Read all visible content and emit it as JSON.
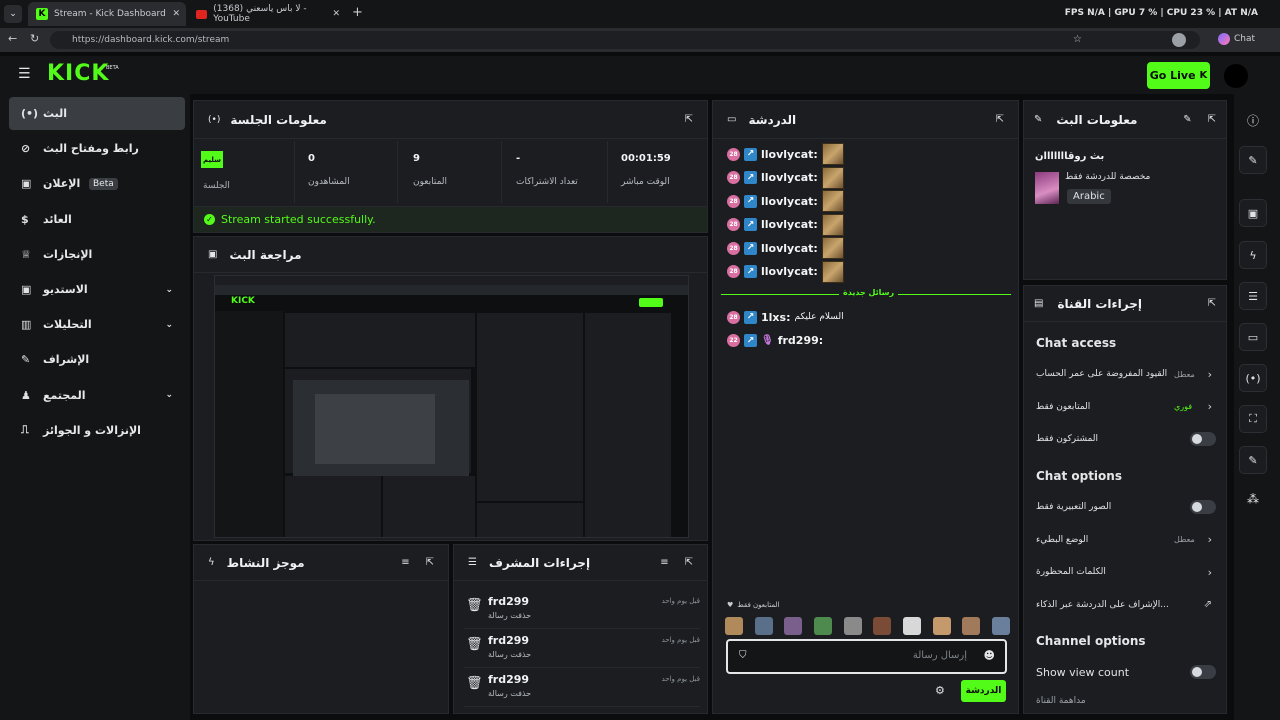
{
  "browser": {
    "tabs": [
      {
        "title": "Stream - Kick Dashboard",
        "active": true
      },
      {
        "title": "(1368) لا باس ياسعني - YouTube",
        "active": false
      }
    ],
    "url": "https://dashboard.kick.com/stream",
    "perf": "FPS N/A | GPU 7 % | CPU 23 % | AT N/A",
    "chat_label": "Chat"
  },
  "app": {
    "logo": "KICK",
    "logo_badge": "BETA",
    "go_live": "Go Live"
  },
  "sidebar": {
    "items": [
      {
        "label": "البث",
        "icon": "(•)",
        "active": true
      },
      {
        "label": "رابط ومفتاح البث",
        "icon": "⊘"
      },
      {
        "label": "الإعلان",
        "icon": "▣",
        "badge": "Beta"
      },
      {
        "label": "العائد",
        "icon": "$"
      },
      {
        "label": "الإنجازات",
        "icon": "♕"
      },
      {
        "label": "الاستديو",
        "icon": "▣",
        "chevron": true
      },
      {
        "label": "التحليلات",
        "icon": "▥",
        "chevron": true
      },
      {
        "label": "الإشراف",
        "icon": "✎"
      },
      {
        "label": "المجتمع",
        "icon": "♟",
        "chevron": true
      },
      {
        "label": "الإنزالات و الجوائز",
        "icon": "⎍"
      }
    ]
  },
  "session": {
    "title": "معلومات الجلسة",
    "stats": [
      {
        "value": "سليم",
        "label": "الجلسة"
      },
      {
        "value": "0",
        "label": "المشاهدون"
      },
      {
        "value": "9",
        "label": "المتابعون"
      },
      {
        "value": "-",
        "label": "تعداد الاشتراكات"
      },
      {
        "value": "00:01:59",
        "label": "الوقت مباشر"
      }
    ],
    "success": "Stream started successfully."
  },
  "preview": {
    "title": "مراجعة البث"
  },
  "activity": {
    "title": "موجز النشاط"
  },
  "modactions": {
    "title": "إجراءات المشرف",
    "rows": [
      {
        "user": "frd299",
        "action": "حذفت رسالة",
        "time": "قبل يوم واحد"
      },
      {
        "user": "frd299",
        "action": "حذفت رسالة",
        "time": "قبل يوم واحد"
      },
      {
        "user": "frd299",
        "action": "حذفت رسالة",
        "time": "قبل يوم واحد"
      }
    ]
  },
  "chat": {
    "title": "الدردشة",
    "messages": [
      {
        "user": "llovlycat:",
        "badge": "28"
      },
      {
        "user": "llovlycat:",
        "badge": "28"
      },
      {
        "user": "llovlycat:",
        "badge": "28"
      },
      {
        "user": "llovlycat:",
        "badge": "28"
      },
      {
        "user": "llovlycat:",
        "badge": "28"
      },
      {
        "user": "llovlycat:",
        "badge": "28"
      }
    ],
    "new_messages": "رسائل جديدة",
    "msg2": [
      {
        "user": "1lxs:",
        "text": "السلام عليكم",
        "badge": "28"
      },
      {
        "user": "frd299:",
        "text": "",
        "badge": "22"
      }
    ],
    "followers_only": "المتابعون فقط",
    "placeholder": "إرسال رسالة",
    "send": "الدردشة"
  },
  "streaminfo": {
    "title": "معلومات البث",
    "stream_title": "بث روقااااااان",
    "category": "مخصصة للدردشة فقط",
    "language": "Arabic"
  },
  "channel": {
    "title": "إجراءات القناة",
    "chat_access": "Chat access",
    "rows_access": [
      {
        "label": "القيود المفروضة على عمر الحساب",
        "value": "معطل",
        "type": "chevron"
      },
      {
        "label": "المتابعون فقط",
        "value": "فوري",
        "type": "chevron",
        "green": true
      },
      {
        "label": "المشتركون فقط",
        "value": "",
        "type": "toggle"
      }
    ],
    "chat_options": "Chat options",
    "rows_options": [
      {
        "label": "الصور التعبيرية فقط",
        "value": "",
        "type": "toggle"
      },
      {
        "label": "الوضع البطيء",
        "value": "معطل",
        "type": "chevron"
      },
      {
        "label": "الكلمات المحظورة",
        "value": "",
        "type": "chevron"
      },
      {
        "label": "الإشراف على الدردشة عبر الذكاء...",
        "value": "",
        "type": "external"
      }
    ],
    "channel_options": "Channel options",
    "show_view_count": "Show view count",
    "last_row": "مداهمة القناة"
  },
  "colors": {
    "accent": "#53fc18",
    "success": "#53fc18"
  }
}
